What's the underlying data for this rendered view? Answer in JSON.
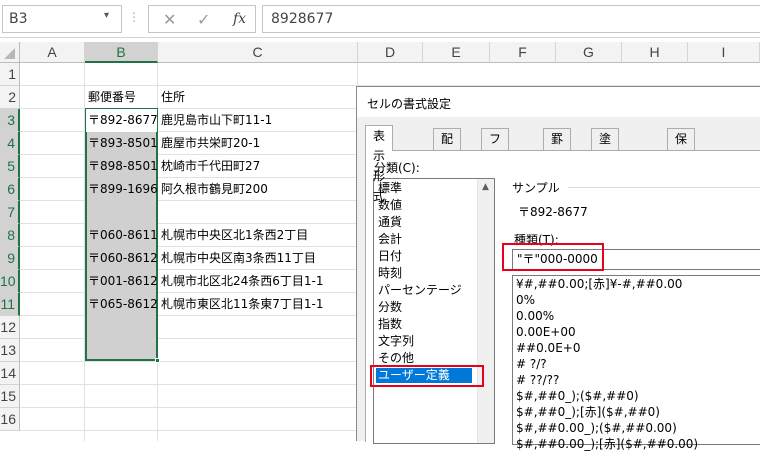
{
  "formula_bar": {
    "name_box": "B3",
    "name_box_arrow": "▾",
    "separator": "⋮",
    "cancel_glyph": "✕",
    "enter_glyph": "✓",
    "fx_label": "fx",
    "formula": "8928677"
  },
  "columns": [
    "A",
    "B",
    "C",
    "D",
    "E",
    "F",
    "G",
    "H",
    "I"
  ],
  "rows": [
    "1",
    "2",
    "3",
    "4",
    "5",
    "6",
    "7",
    "8",
    "9",
    "10",
    "11",
    "12",
    "13",
    "14",
    "15",
    "16"
  ],
  "cells": {
    "b2": "郵便番号",
    "c2": "住所",
    "b3": "〒892-8677",
    "c3": "鹿児島市山下町11-1",
    "b4": "〒893-8501",
    "c4": "鹿屋市共栄町20-1",
    "b5": "〒898-8501",
    "c5": "枕崎市千代田町27",
    "b6": "〒899-1696",
    "c6": "阿久根市鶴見町200",
    "b8": "〒060-8611",
    "c8": "札幌市中央区北1条西2丁目",
    "b9": "〒060-8612",
    "c9": "札幌市中央区南3条西11丁目",
    "b10": "〒001-8612",
    "c10": "札幌市北区北24条西6丁目1-1",
    "b11": "〒065-8612",
    "c11": "札幌市東区北11条東7丁目1-1"
  },
  "dialog": {
    "title": "セルの書式設定",
    "tabs": [
      "表示形式",
      "配置",
      "フォント",
      "罫線",
      "塗りつぶし",
      "保護"
    ],
    "category_label": "分類(C):",
    "categories": [
      "標準",
      "数値",
      "通貨",
      "会計",
      "日付",
      "時刻",
      "パーセンテージ",
      "分数",
      "指数",
      "文字列",
      "その他",
      "ユーザー定義"
    ],
    "selected_category": "ユーザー定義",
    "sample_label": "サンプル",
    "sample_value": "〒892-8677",
    "type_label": "種類(T):",
    "type_value": "\"〒\"000-0000",
    "formats": [
      "¥#,##0.00;[赤]¥-#,##0.00",
      "0%",
      "0.00%",
      "0.00E+00",
      "##0.0E+0",
      "# ?/?",
      "# ??/??",
      "$#,##0_);($#,##0)",
      "$#,##0_);[赤]($#,##0)",
      "$#,##0.00_);($#,##0.00)",
      "$#,##0.00_);[赤]($#,##0.00)"
    ]
  },
  "colors": {
    "accent_green": "#217346",
    "selection_blue": "#0078d7",
    "highlight_red": "#e8001c"
  }
}
